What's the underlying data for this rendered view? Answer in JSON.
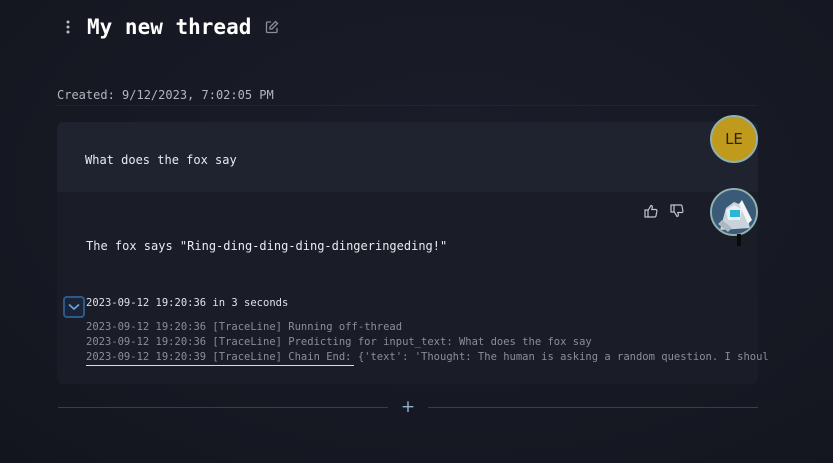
{
  "thread": {
    "title": "My new thread",
    "created": "Created: 9/12/2023, 7:02:05 PM"
  },
  "icons": {
    "menu": "vertical-dots-icon",
    "edit": "pencil-icon",
    "thumbs_up": "thumbs-up-icon",
    "thumbs_down": "thumbs-down-icon",
    "toggle": "chevron-down-icon",
    "add": "plus-icon"
  },
  "messages": {
    "user": {
      "text": "What does the fox say",
      "avatar_initials": "LE"
    },
    "bot": {
      "text": "The fox says \"Ring-ding-ding-ding-dingeringeding!\""
    }
  },
  "trace": {
    "header": "2023-09-12 19:20:36 in 3 seconds",
    "lines": [
      "2023-09-12 19:20:36 [TraceLine] Running off-thread",
      "2023-09-12 19:20:36 [TraceLine] Predicting for input_text: What does the fox say",
      "2023-09-12 19:20:39 [TraceLine] Chain End: {'text': 'Thought: The human is asking a random question. I shoul"
    ]
  },
  "actions": {
    "add_label": "+"
  },
  "colors": {
    "background": "#161823",
    "card": "#1a1d28",
    "user_bubble": "#1f2330",
    "user_avatar": "#c09a1c",
    "accent": "#2b5a88"
  }
}
